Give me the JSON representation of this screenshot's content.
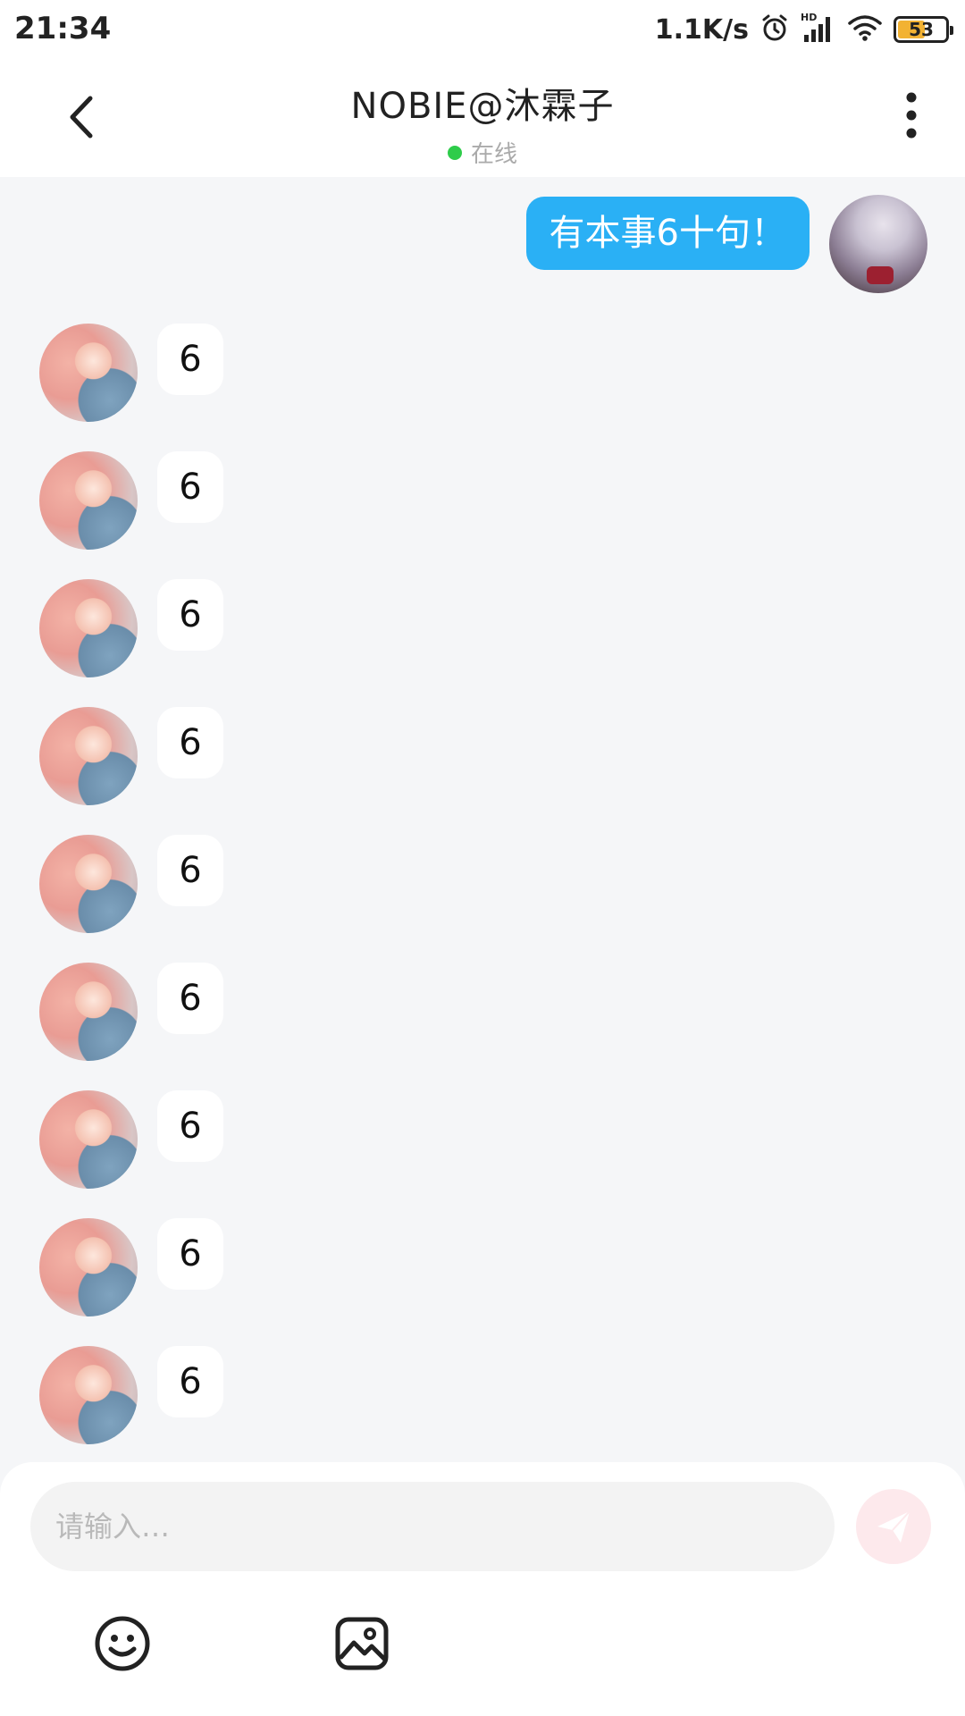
{
  "status_bar": {
    "time": "21:34",
    "network_speed": "1.1K/s",
    "battery_level": "53",
    "battery_fraction": 0.53,
    "icons": [
      "alarm-icon",
      "hd-signal-icon",
      "wifi-icon",
      "battery-icon"
    ]
  },
  "header": {
    "title": "NOBIE@沐霖子",
    "presence": "在线",
    "presence_color": "#2ecc4a"
  },
  "messages": {
    "outgoing": [
      {
        "text": "有本事6十句！"
      }
    ],
    "incoming": [
      {
        "text": "6"
      },
      {
        "text": "6"
      },
      {
        "text": "6"
      },
      {
        "text": "6"
      },
      {
        "text": "6"
      },
      {
        "text": "6"
      },
      {
        "text": "6"
      },
      {
        "text": "6"
      },
      {
        "text": "6"
      }
    ]
  },
  "composer": {
    "placeholder": "请输入…",
    "value": ""
  },
  "colors": {
    "outgoing_bubble": "#2ab0f5",
    "incoming_bubble": "#ffffff",
    "background": "#f5f6f8",
    "send_button_disabled": "#fde9ec"
  }
}
